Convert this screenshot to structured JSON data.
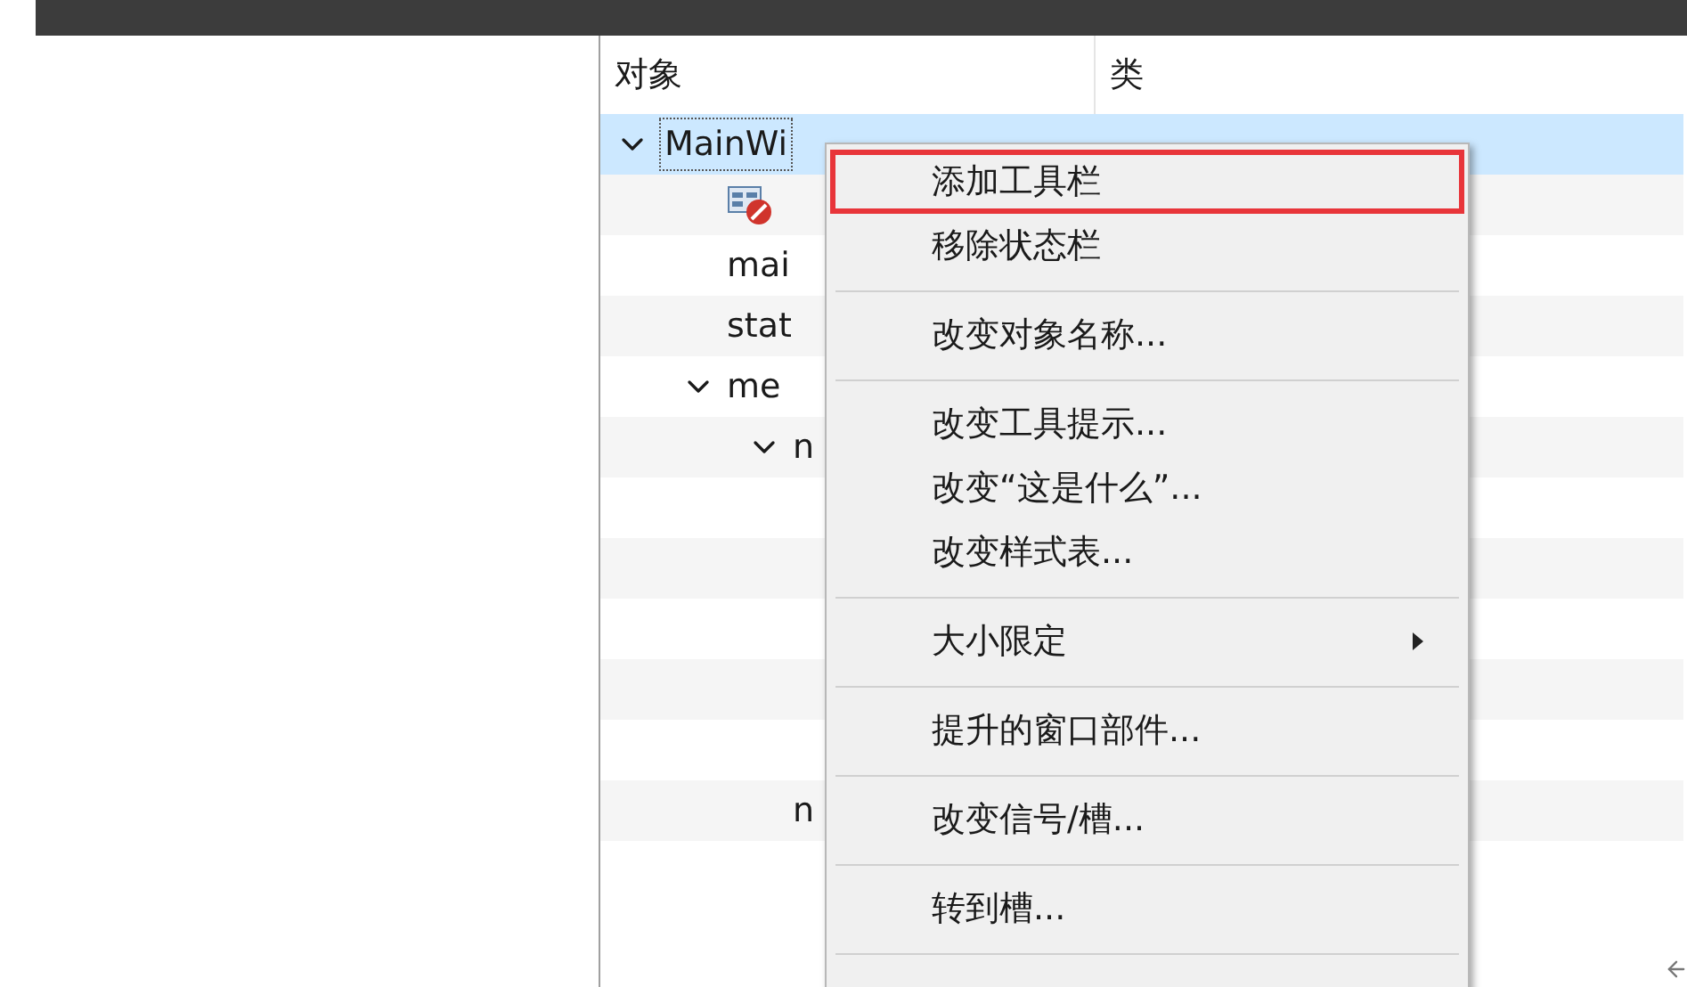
{
  "tree": {
    "columns": [
      "对象",
      "类"
    ],
    "rows": [
      {
        "kind": "object",
        "label": "MainWi",
        "expanded": true,
        "selected": true,
        "children": [
          {
            "kind": "widget",
            "selected": false
          },
          {
            "kind": "object",
            "label": "mai",
            "selected": false
          },
          {
            "kind": "object",
            "label": "stat",
            "selected": false
          },
          {
            "kind": "object",
            "label": "me",
            "expanded": true,
            "selected": false,
            "children": [
              {
                "kind": "object",
                "label": "n",
                "expanded": true,
                "selected": false,
                "children": [
                  {
                    "selected": false
                  },
                  {
                    "selected": false
                  },
                  {
                    "selected": false
                  },
                  {
                    "selected": false
                  },
                  {
                    "selected": false
                  }
                ]
              },
              {
                "kind": "object",
                "label": "n",
                "selected": false
              }
            ]
          }
        ]
      }
    ]
  },
  "context_menu": {
    "items": [
      {
        "kind": "item",
        "label": "添加工具栏",
        "highlighted": true
      },
      {
        "kind": "item",
        "label": "移除状态栏",
        "highlighted": false
      },
      {
        "kind": "separator"
      },
      {
        "kind": "item",
        "label": "改变对象名称...",
        "highlighted": false
      },
      {
        "kind": "separator"
      },
      {
        "kind": "item",
        "label": "改变工具提示...",
        "highlighted": false
      },
      {
        "kind": "item",
        "label": "改变“这是什么”...",
        "highlighted": false
      },
      {
        "kind": "item",
        "label": "改变样式表...",
        "highlighted": false
      },
      {
        "kind": "separator"
      },
      {
        "kind": "submenu",
        "label": "大小限定",
        "highlighted": false
      },
      {
        "kind": "separator"
      },
      {
        "kind": "item",
        "label": "提升的窗口部件...",
        "highlighted": false
      },
      {
        "kind": "separator"
      },
      {
        "kind": "item",
        "label": "改变信号/槽...",
        "highlighted": false
      },
      {
        "kind": "separator"
      },
      {
        "kind": "item",
        "label": "转到槽...",
        "highlighted": false
      },
      {
        "kind": "separator"
      }
    ]
  }
}
